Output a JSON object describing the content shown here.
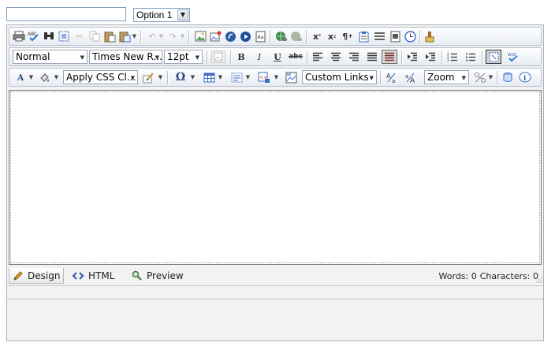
{
  "top": {
    "text_input_value": "",
    "option_select": "Option 1"
  },
  "toolbar2": {
    "paragraph_style": "Normal",
    "font_name": "Times New R...",
    "font_size": "12pt"
  },
  "toolbar3": {
    "css_class": "Apply CSS Cl...",
    "custom_links": "Custom Links",
    "zoom": "Zoom"
  },
  "modes": {
    "design": "Design",
    "html": "HTML",
    "preview": "Preview"
  },
  "stats": {
    "words_label": "Words: 0",
    "characters_label": "Characters: 0"
  },
  "icons": {
    "print": "print-icon",
    "spell": "spellcheck-icon",
    "find": "find-icon",
    "select_all": "select-all-icon",
    "cut": "cut-icon",
    "copy": "copy-icon",
    "paste": "paste-icon",
    "paste_special": "paste-special-icon",
    "undo": "undo-icon",
    "redo": "redo-icon",
    "image": "image-icon",
    "image_map": "image-map-icon",
    "flash": "flash-icon",
    "media": "media-icon",
    "document": "document-icon",
    "hyperlink": "hyperlink-icon",
    "remove_link": "remove-link-icon",
    "superscript": "superscript-icon",
    "subscript": "subscript-icon",
    "paragraph": "paragraph-icon",
    "form": "form-icon",
    "hr": "horizontal-rule-icon",
    "snippet": "snippet-icon",
    "date": "date-icon",
    "format_stripper": "format-stripper-icon",
    "bold": "bold-icon",
    "italic": "italic-icon",
    "underline": "underline-icon",
    "strike": "strikethrough-icon",
    "align_left": "align-left-icon",
    "align_center": "align-center-icon",
    "align_right": "align-right-icon",
    "justify": "justify-icon",
    "justify_none": "justify-none-icon",
    "outdent": "outdent-icon",
    "indent": "indent-icon",
    "ordered_list": "ordered-list-icon",
    "bullet_list": "bullet-list-icon",
    "show_borders": "toggle-borders-icon",
    "w3c": "xhtml-validator-icon",
    "foreground_color": "foreground-color-icon",
    "background_color": "highlight-color-icon",
    "format_brush": "format-brush-icon",
    "special_chars": "special-chars-icon",
    "table": "table-icon",
    "paragraph_format": "paragraph-format-icon",
    "insert_element": "insert-element-icon",
    "template": "template-icon",
    "convert_upper": "convert-upper-icon",
    "convert_lower": "convert-lower-icon",
    "module_manager": "module-manager-icon",
    "repeat": "repeat-icon",
    "about": "about-icon",
    "help": "help-icon"
  },
  "colors": {
    "toolbar_border": "#b8c0cc",
    "editor_border": "#777777",
    "panel_bg": "#f2f2f2",
    "input_border": "#7f9db9"
  }
}
